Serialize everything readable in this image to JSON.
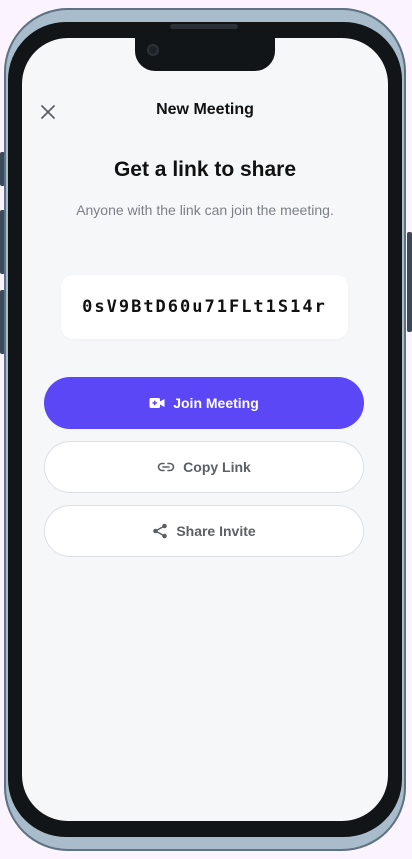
{
  "header": {
    "title": "New Meeting",
    "close_icon": "close-icon"
  },
  "main": {
    "headline": "Get a link to share",
    "subtext": "Anyone with the link can join the meeting.",
    "meeting_code": "0sV9BtD60u71FLt1S14r"
  },
  "actions": {
    "join": {
      "label": "Join Meeting",
      "icon": "video-camera-icon"
    },
    "copy": {
      "label": "Copy Link",
      "icon": "link-icon"
    },
    "share": {
      "label": "Share Invite",
      "icon": "share-icon"
    }
  },
  "colors": {
    "primary": "#5b47f5",
    "background": "#f6f7f9",
    "frame": "#a9bccc",
    "bezel": "#111518"
  }
}
